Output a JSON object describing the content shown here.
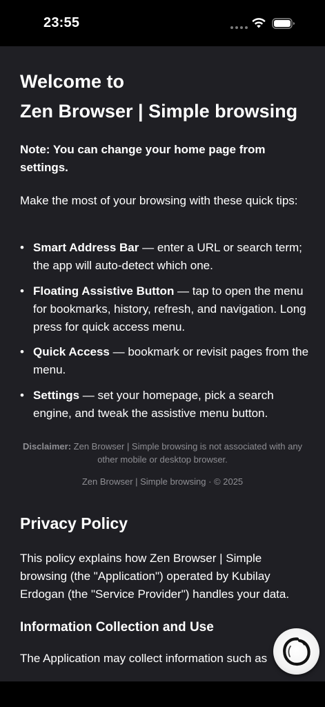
{
  "status_bar": {
    "time": "23:55",
    "icons": [
      "signal-dots-icon",
      "wifi-icon",
      "battery-icon"
    ]
  },
  "welcome": {
    "title_line1": "Welcome to",
    "title_line2": "Zen Browser | Simple browsing",
    "note": "Note: You can change your home page from settings.",
    "intro": "Make the most of your browsing with these quick tips:"
  },
  "tips": [
    {
      "title": "Smart Address Bar",
      "text": " — enter a URL or search term; the app will auto-detect which one."
    },
    {
      "title": "Floating Assistive Button",
      "text": " — tap to open the menu for bookmarks, history, refresh, and navigation. Long press for quick access menu."
    },
    {
      "title": "Quick Access",
      "text": " — bookmark or revisit pages from the menu."
    },
    {
      "title": "Settings",
      "text": " — set your homepage, pick a search engine, and tweak the assistive menu button."
    }
  ],
  "disclaimer": {
    "label": "Disclaimer:",
    "text": " Zen Browser | Simple browsing is not associated with any other mobile or desktop browser."
  },
  "copyright": "Zen Browser | Simple browsing · © 2025",
  "privacy": {
    "title": "Privacy Policy",
    "body": "This policy explains how Zen Browser | Simple browsing (the \"Application\") operated by Kubilay Erdogan (the \"Service Provider\") handles your data.",
    "section_title": "Information Collection and Use",
    "section_body": "The Application may collect information such as"
  },
  "assistive_button": {
    "icon": "enso-circle-icon"
  },
  "colors": {
    "background": "#1f1f24",
    "text": "#ffffff",
    "muted": "#8e8e93",
    "bars": "#000000"
  }
}
